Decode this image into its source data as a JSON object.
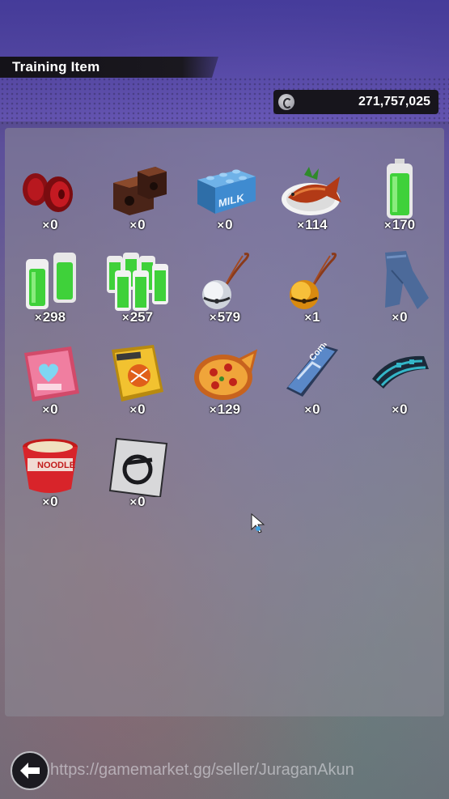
{
  "header": {
    "title": "Training Item"
  },
  "currency": {
    "icon": "zeni-coin-icon",
    "amount": "271,757,025"
  },
  "items": [
    {
      "name": "weights-red-icon",
      "count": "0"
    },
    {
      "name": "weights-brown-icon",
      "count": "0"
    },
    {
      "name": "milk-block-icon",
      "count": "0"
    },
    {
      "name": "fish-dish-icon",
      "count": "114"
    },
    {
      "name": "battery-icon",
      "count": "170"
    },
    {
      "name": "battery-pair-icon",
      "count": "298"
    },
    {
      "name": "battery-pack-icon",
      "count": "257"
    },
    {
      "name": "silver-bell-icon",
      "count": "579"
    },
    {
      "name": "gold-bell-icon",
      "count": "1"
    },
    {
      "name": "jeans-icon",
      "count": "0"
    },
    {
      "name": "photo-book-icon",
      "count": "0"
    },
    {
      "name": "guide-book-icon",
      "count": "0"
    },
    {
      "name": "pizza-icon",
      "count": "129"
    },
    {
      "name": "comic-book-icon",
      "count": "0"
    },
    {
      "name": "scarf-icon",
      "count": "0"
    },
    {
      "name": "ramen-cup-icon",
      "count": "0"
    },
    {
      "name": "capsule-card-icon",
      "count": "0"
    }
  ],
  "count_prefix": "×",
  "footer": {
    "back_icon": "back-arrow-icon",
    "watermark": "https://gamemarket.gg/seller/JuraganAkun"
  }
}
